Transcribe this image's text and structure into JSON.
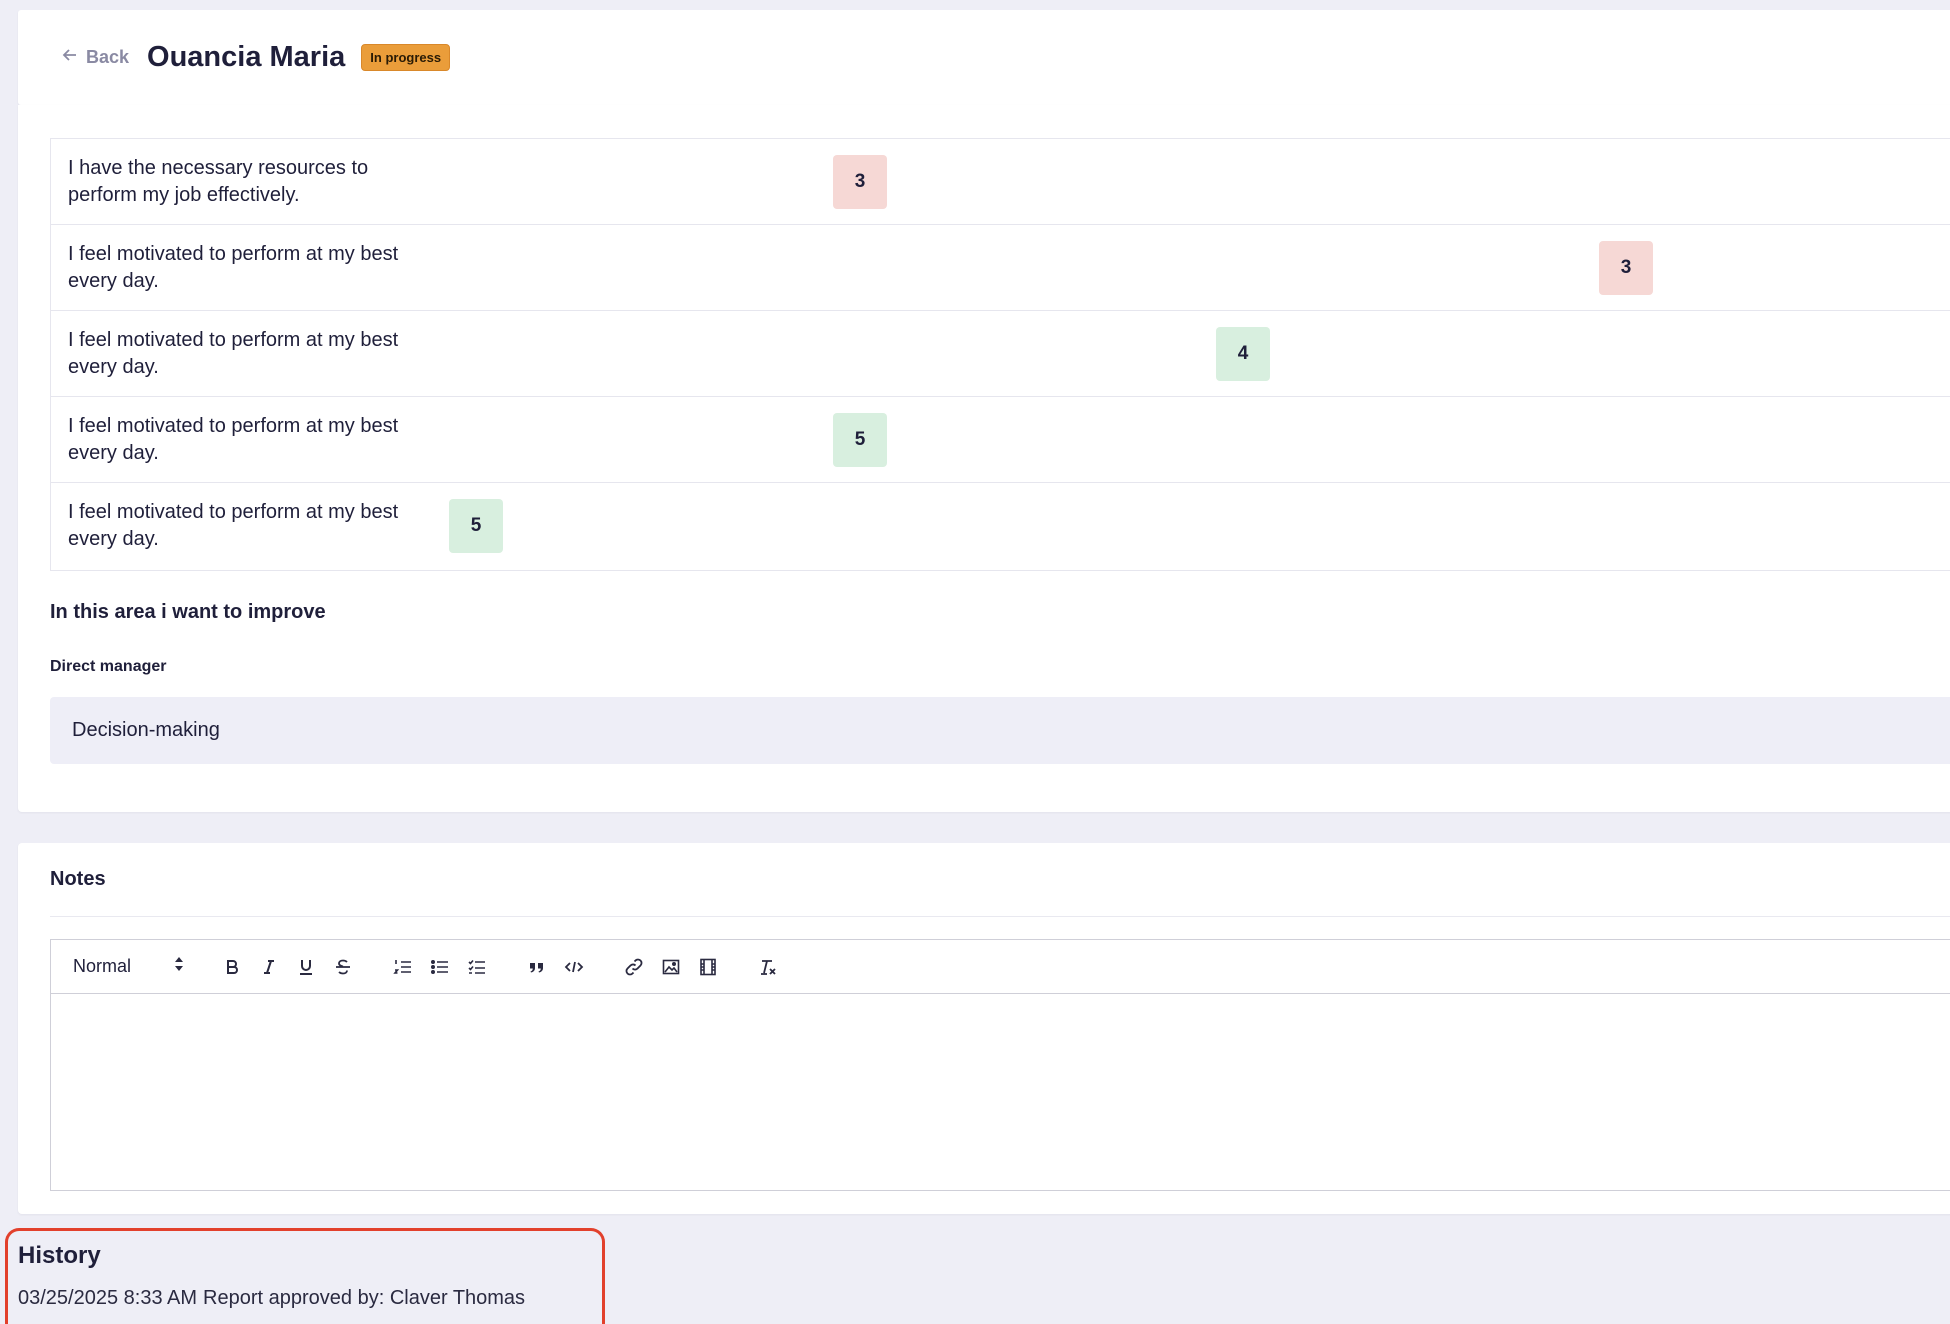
{
  "header": {
    "back_label": "Back",
    "title": "Ouancia Maria",
    "status": "In progress",
    "status_color": "#ea9d3a"
  },
  "survey": {
    "rows": [
      {
        "question": "I have the necessary resources to perform my job effectively.",
        "score": "3",
        "level": "low"
      },
      {
        "question": "I feel motivated to perform at my best every day.",
        "score": "3",
        "level": "low"
      },
      {
        "question": "I feel motivated to perform at my best every day.",
        "score": "4",
        "level": "high"
      },
      {
        "question": "I feel motivated to perform at my best every day.",
        "score": "5",
        "level": "high"
      },
      {
        "question": "I feel motivated to perform at my best every day.",
        "score": "5",
        "level": "high"
      }
    ],
    "low_color": "#f6d8d5",
    "high_color": "#d8efdf"
  },
  "improve": {
    "heading": "In this area i want to improve",
    "manager_label": "Direct manager",
    "manager_value": "Decision-making"
  },
  "notes": {
    "heading": "Notes",
    "format_value": "Normal",
    "toolbar_icons": [
      "bold-icon",
      "italic-icon",
      "underline-icon",
      "strike-icon",
      "ordered-list-icon",
      "bullet-list-icon",
      "check-list-icon",
      "blockquote-icon",
      "code-icon",
      "link-icon",
      "image-icon",
      "video-icon",
      "clear-format-icon"
    ]
  },
  "history": {
    "title": "History",
    "entries": [
      {
        "timestamp": "03/25/2025 8:33 AM",
        "text": "Report approved by: Claver Thomas"
      }
    ],
    "highlight_color": "#e2402c"
  }
}
